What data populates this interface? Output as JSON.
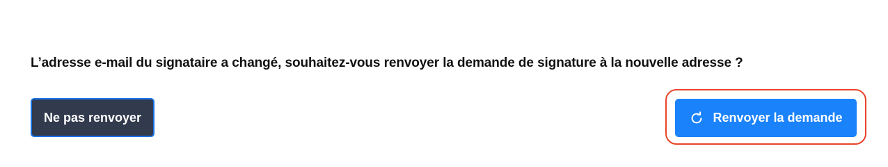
{
  "dialog": {
    "question": "L’adresse e-mail du signataire a changé, souhaitez-vous renvoyer la demande de signature à la nouvelle adresse ?",
    "secondary_button": {
      "label": "Ne pas renvoyer"
    },
    "primary_button": {
      "label": "Renvoyer la demande",
      "icon": "refresh-icon"
    }
  },
  "colors": {
    "primary": "#1a82fb",
    "secondary": "#323a4e",
    "focus_ring": "#e8442a"
  }
}
